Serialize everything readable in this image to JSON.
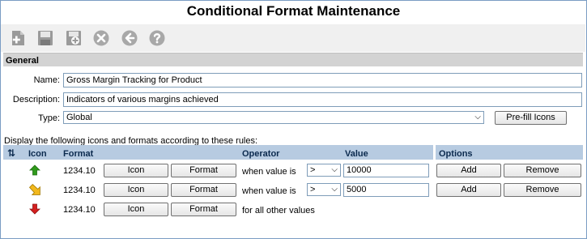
{
  "title": "Conditional Format Maintenance",
  "toolbar": {
    "new": "new-icon",
    "save": "save-icon",
    "save_copy": "save-as-icon",
    "delete": "delete-icon",
    "back": "back-icon",
    "help": "help-icon"
  },
  "general": {
    "header": "General",
    "name_label": "Name:",
    "name_value": "Gross Margin Tracking for Product",
    "description_label": "Description:",
    "description_value": "Indicators of various margins achieved",
    "type_label": "Type:",
    "type_value": "Global",
    "prefill_label": "Pre-fill Icons"
  },
  "rules": {
    "intro": "Display the following icons and formats according to these rules:",
    "sort_icon": "sort-icon",
    "columns": {
      "icon": "Icon",
      "format": "Format",
      "operator": "Operator",
      "value": "Value",
      "options": "Options"
    },
    "rows": [
      {
        "icon": "arrow-up-green-icon",
        "sample": "1234.10",
        "icon_button": "Icon",
        "format_button": "Format",
        "condition": "when value is",
        "operator": ">",
        "value": "10000",
        "add": "Add",
        "remove": "Remove"
      },
      {
        "icon": "arrow-diagonal-yellow-icon",
        "sample": "1234.10",
        "icon_button": "Icon",
        "format_button": "Format",
        "condition": "when value is",
        "operator": ">",
        "value": "5000",
        "add": "Add",
        "remove": "Remove"
      },
      {
        "icon": "arrow-down-red-icon",
        "sample": "1234.10",
        "icon_button": "Icon",
        "format_button": "Format",
        "condition": "for all other values"
      }
    ]
  },
  "colors": {
    "header_band": "#d3d3d3",
    "table_header": "#b7cbe1",
    "up": "#2e9a1b",
    "mid": "#f2b81c",
    "down": "#d41f1f"
  }
}
